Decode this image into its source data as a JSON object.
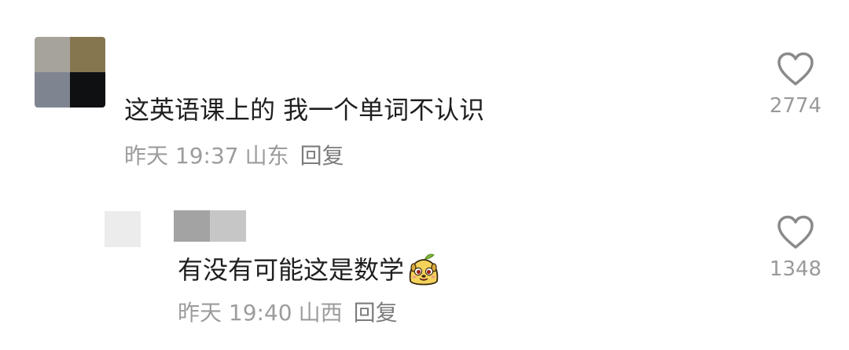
{
  "comments": [
    {
      "text": "这英语课上的 我一个单词不认识",
      "time": "昨天 19:37",
      "region": "山东",
      "reply_label": "回复",
      "like_count": "2774",
      "avatar_icon": "pixelated-avatar"
    },
    {
      "text": "有没有可能这是数学",
      "emoji_icon": "cute-yellow-dog-emoji",
      "time": "昨天 19:40",
      "region": "山西",
      "reply_label": "回复",
      "like_count": "1348",
      "avatar_icon": "pixelated-avatar"
    }
  ],
  "colors": {
    "text": "#1f1f1f",
    "meta": "#9c9c9c",
    "icon": "#8a8a8a"
  }
}
